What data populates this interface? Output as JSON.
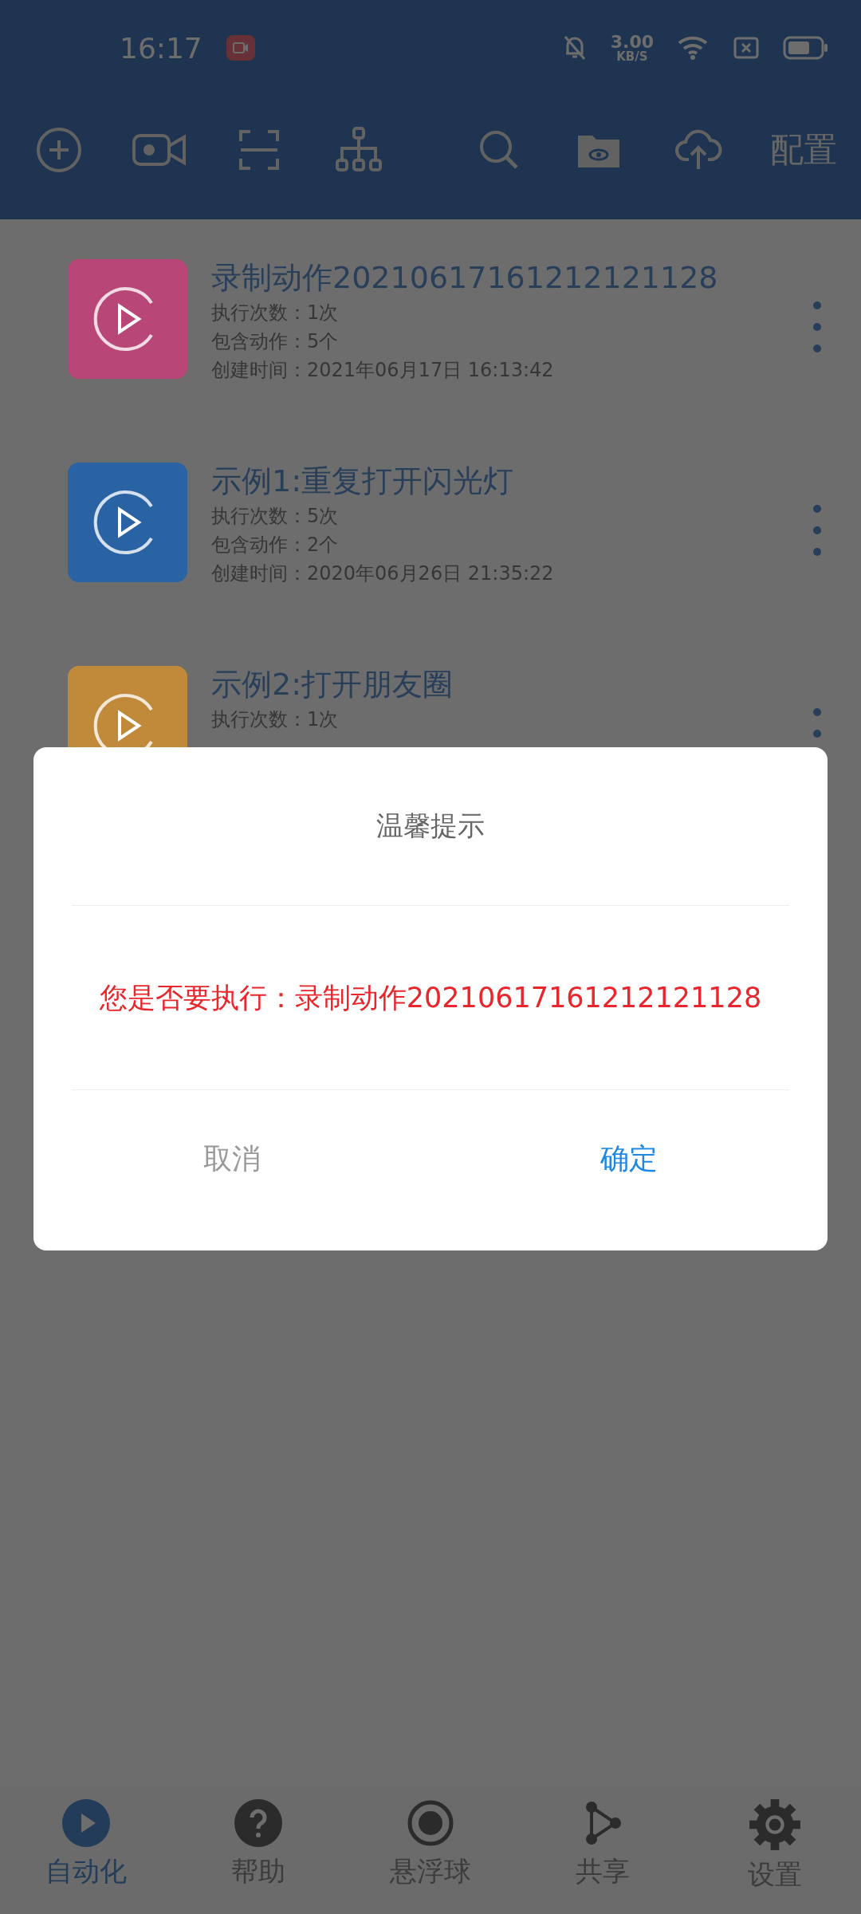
{
  "status_bar": {
    "time": "16:17",
    "net_speed": "3.00",
    "net_unit": "KB/S"
  },
  "toolbar": {
    "config_label": "配置"
  },
  "actions": [
    {
      "title": "录制动作20210617161212121128",
      "color": "#b84677",
      "lines": [
        "执行次数：1次",
        "包含动作：5个",
        "创建时间：2021年06月17日 16:13:42"
      ]
    },
    {
      "title": "示例1:重复打开闪光灯",
      "color": "#2a63a4",
      "lines": [
        "执行次数：5次",
        "包含动作：2个",
        "创建时间：2020年06月26日 21:35:22"
      ]
    },
    {
      "title": "示例2:打开朋友圈",
      "color": "#c08a3a",
      "lines": [
        "执行次数：1次"
      ]
    }
  ],
  "dialog": {
    "title": "温馨提示",
    "message": "您是否要执行：录制动作20210617161212121128",
    "cancel": "取消",
    "confirm": "确定"
  },
  "bottom_nav": [
    {
      "label": "自动化",
      "kind": "play",
      "selected": true
    },
    {
      "label": "帮助",
      "kind": "help",
      "selected": false
    },
    {
      "label": "悬浮球",
      "kind": "ball",
      "selected": false
    },
    {
      "label": "共享",
      "kind": "share",
      "selected": false
    },
    {
      "label": "设置",
      "kind": "gear",
      "selected": false
    }
  ]
}
